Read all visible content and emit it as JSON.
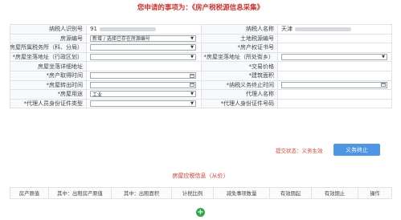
{
  "page": {
    "title": "您申请的事项为：《房产税税源信息采集》"
  },
  "form": {
    "taxpayer_id_label": "纳税人识别号",
    "taxpayer_id_value": "91",
    "taxpayer_name_label": "纳税人名称",
    "taxpayer_name_value": "天津",
    "property_no_label": "房源编号",
    "property_no_select": "新增 / 选择已存在房源编号",
    "land_tax_no_label": "土地税源编号",
    "tax_office_label": "*房屋所属税务所（科、分局）",
    "property_cert_label": "*房产权证书号",
    "address_admin_label": "*房屋坐落地址（行政区划）",
    "address_street_label": "*房屋坐落地址（所处街乡）",
    "address_detail_label": "房屋坐落详细地址",
    "trade_price_label": "*交易价格",
    "acquire_time_label": "*房产取得时间",
    "building_area_label": "*建筑面积",
    "transfer_time_label": "*房屋转出时间",
    "tax_end_time_label": "*纳税义务终止时间",
    "usage_label": "*房屋用途",
    "usage_value": "工业",
    "agent_name_label": "代理人名称",
    "agent_id_type_label": "*代理人员身份证件类型",
    "agent_id_no_label": "*代理人身份证件号码"
  },
  "status": {
    "prefix": "提交状态：",
    "value": "义务生效"
  },
  "buttons": {
    "terminate": "义务终止",
    "add": "+"
  },
  "section": {
    "title": "房屋应税信息（从价）"
  },
  "table": {
    "headers": [
      "房产原值",
      "其中：出租房产原值",
      "其中：出租面积",
      "计税比例",
      "减免事项数量",
      "有效期起",
      "有效期止",
      "操作"
    ]
  },
  "icons": {
    "calendar": "calendar-icon",
    "dropdown": "chevron-down-icon",
    "add": "plus-circle-icon"
  },
  "colors": {
    "title_red": "#d9302a",
    "button_blue": "#4f95e6",
    "add_green": "#2aa844"
  }
}
